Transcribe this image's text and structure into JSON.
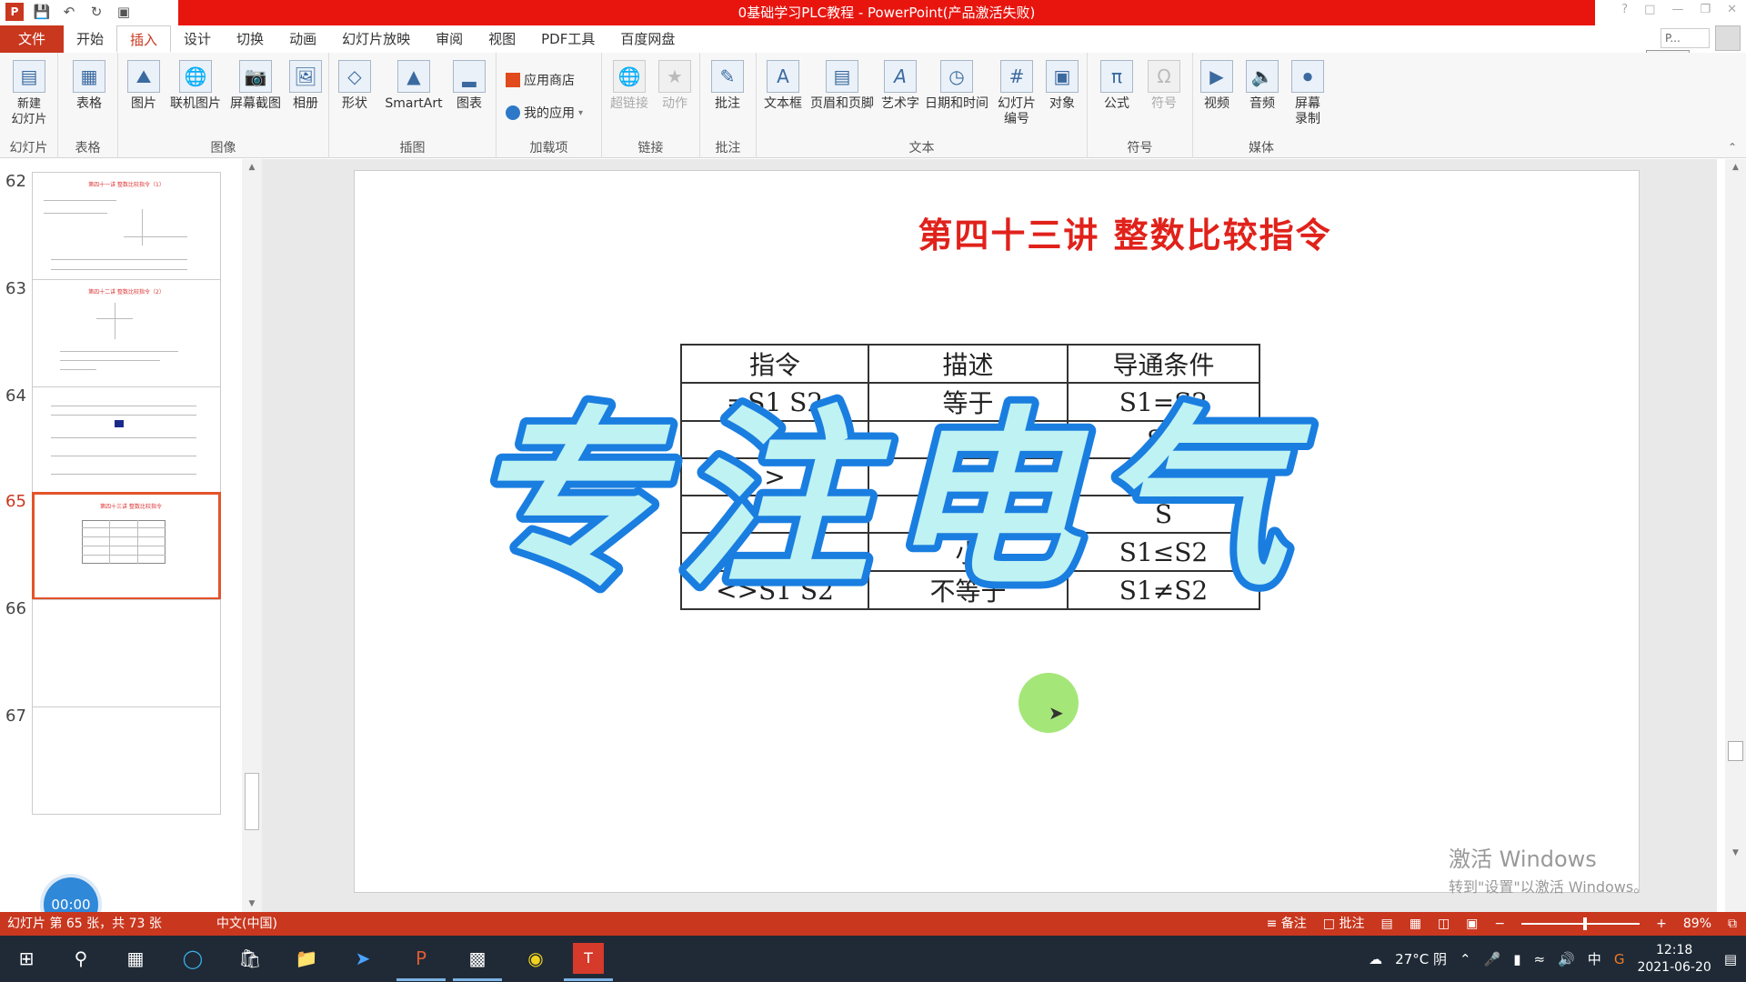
{
  "window": {
    "title": "0基础学习PLC教程 - PowerPoint(产品激活失败)",
    "user_box": "P...",
    "start_tooltip": "开始"
  },
  "tabs": [
    "文件",
    "开始",
    "插入",
    "设计",
    "切换",
    "动画",
    "幻灯片放映",
    "审阅",
    "视图",
    "PDF工具",
    "百度网盘"
  ],
  "active_tab": "插入",
  "ribbon": {
    "groups": {
      "slides": "幻灯片",
      "tables": "表格",
      "images": "图像",
      "illustrations": "插图",
      "addins": "加载项",
      "links": "链接",
      "comments": "批注",
      "text": "文本",
      "symbols": "符号",
      "media": "媒体"
    },
    "buttons": {
      "new_slide": "新建\n幻灯片",
      "table": "表格",
      "picture": "图片",
      "online_picture": "联机图片",
      "screenshot": "屏幕截图",
      "album": "相册",
      "shapes": "形状",
      "smartart": "SmartArt",
      "chart": "图表",
      "store": "应用商店",
      "my_apps": "我的应用",
      "hyperlink": "超链接",
      "action": "动作",
      "comment": "批注",
      "textbox": "文本框",
      "header_footer": "页眉和页脚",
      "wordart": "艺术字",
      "datetime": "日期和时间",
      "slide_number": "幻灯片\n编号",
      "object": "对象",
      "equation": "公式",
      "symbol": "符号",
      "video": "视频",
      "audio": "音频",
      "screen_record": "屏幕\n录制"
    }
  },
  "thumbnails": [
    {
      "num": "62",
      "title": "第四十一讲 整数比较指令（1）"
    },
    {
      "num": "63",
      "title": "第四十二讲 整数比较指令（2）"
    },
    {
      "num": "64",
      "title": ""
    },
    {
      "num": "65",
      "title": "第四十三讲 整数比较指令"
    },
    {
      "num": "66",
      "title": ""
    },
    {
      "num": "67",
      "title": ""
    }
  ],
  "timer": "00:00",
  "slide": {
    "title": "第四十三讲   整数比较指令",
    "table_headers": [
      "指令",
      "描述",
      "导通条件"
    ],
    "rows": [
      [
        "=S1 S2",
        "等于",
        "S1=S2"
      ],
      [
        "",
        "",
        "S1"
      ],
      [
        ">",
        "",
        "S1"
      ],
      [
        "",
        "",
        "S"
      ],
      [
        "",
        "小",
        "S1≤S2"
      ],
      [
        "<>S1  S2",
        "不等于",
        "S1≠S2"
      ]
    ],
    "watermark": "专注电气"
  },
  "activation": {
    "line1": "激活 Windows",
    "line2": "转到\"设置\"以激活 Windows。"
  },
  "statusbar": {
    "slide_info": "幻灯片 第 65 张，共 73 张",
    "language": "中文(中国)",
    "notes": "备注",
    "comments": "批注",
    "zoom": "89%"
  },
  "taskbar": {
    "weather": "27°C 阴",
    "ime": "中",
    "time": "12:18",
    "date": "2021-06-20"
  },
  "colors": {
    "accent": "#c9371f",
    "title_red": "#e8150f",
    "slide_title": "#e0221b",
    "watermark_fill": "#bff2f2",
    "watermark_stroke": "#1a7ee0"
  }
}
